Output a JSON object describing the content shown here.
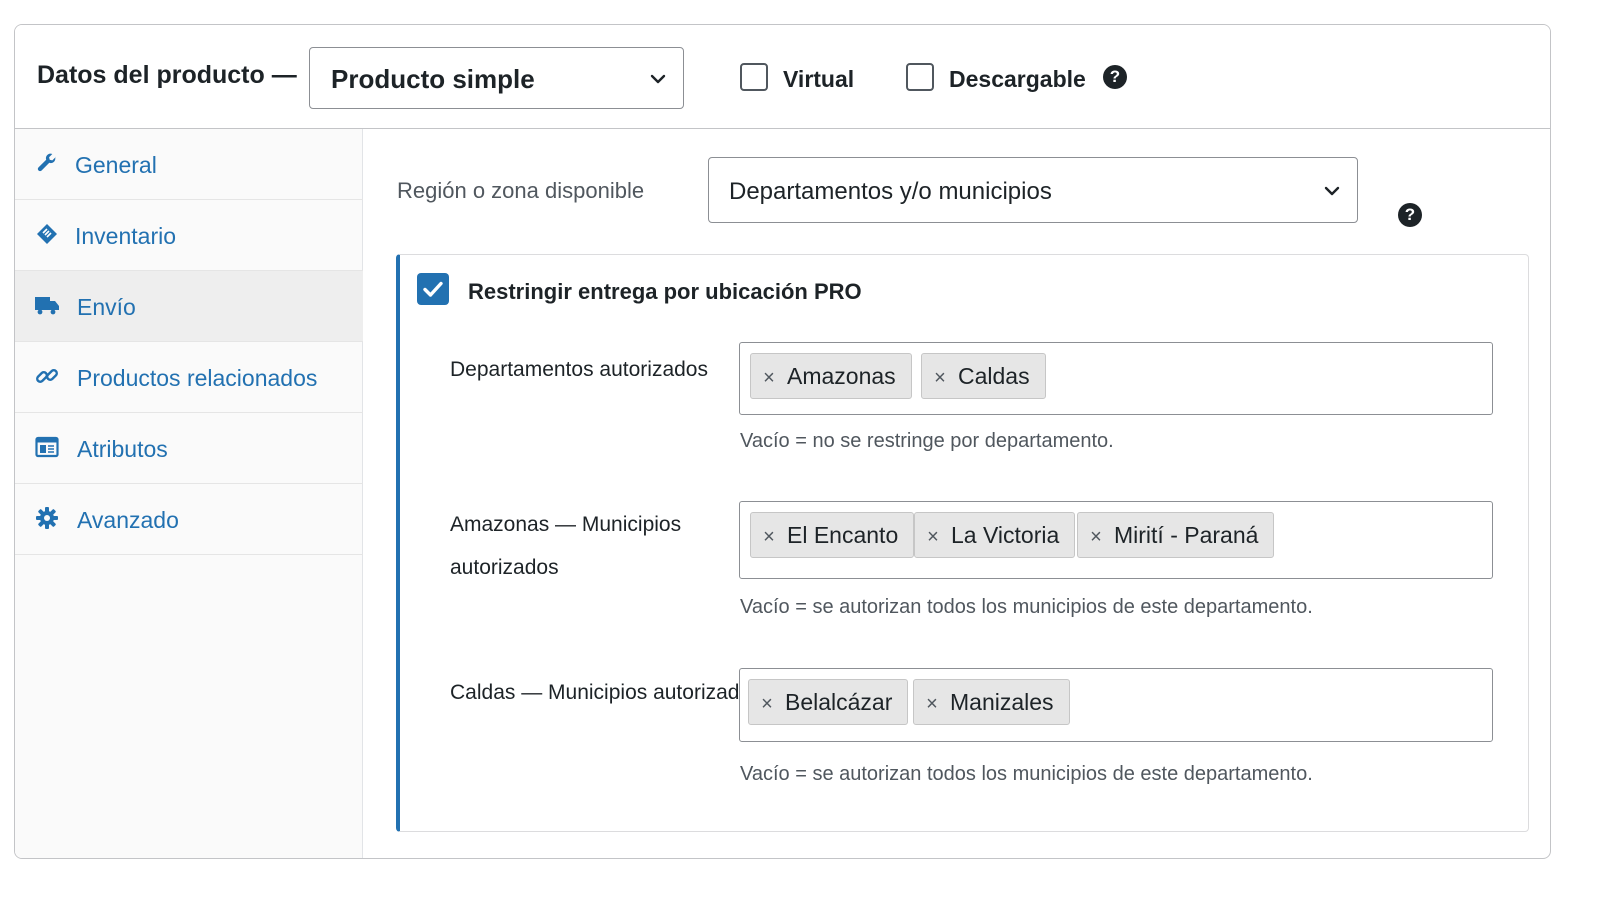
{
  "header": {
    "title": "Datos del producto —",
    "product_type": "Producto simple",
    "virtual_label": "Virtual",
    "virtual_checked": false,
    "downloadable_label": "Descargable",
    "downloadable_checked": false,
    "help_icon": "?"
  },
  "sidebar": {
    "items": [
      {
        "label": "General",
        "icon": "wrench-icon"
      },
      {
        "label": "Inventario",
        "icon": "tag-icon"
      },
      {
        "label": "Envío",
        "icon": "truck-icon",
        "active": true
      },
      {
        "label": "Productos relacionados",
        "icon": "link-icon"
      },
      {
        "label": "Atributos",
        "icon": "table-icon"
      },
      {
        "label": "Avanzado",
        "icon": "gear-icon"
      }
    ]
  },
  "main": {
    "region_label": "Región o zona disponible",
    "region_value": "Departamentos y/o municipios",
    "help_icon": "?",
    "restrict": {
      "checked": true,
      "title": "Restringir entrega por ubicación PRO",
      "departments": {
        "label": "Departamentos autorizados",
        "tags": [
          "Amazonas",
          "Caldas"
        ],
        "hint": "Vacío  =  no se restringe por departamento."
      },
      "amazonas": {
        "label_line1": "Amazonas — Municipios",
        "label_line2": "autorizados",
        "tags": [
          "El Encanto",
          "La Victoria",
          "Mirití - Paraná"
        ],
        "hint": "Vacío  =  se autorizan todos los municipios de este departamento."
      },
      "caldas": {
        "label": "Caldas — Municipios autorizados",
        "tags": [
          "Belalcázar",
          "Manizales"
        ],
        "hint": "Vacío  =  se autorizan todos los municipios de este departamento."
      }
    },
    "tag_remove_symbol": "×"
  }
}
